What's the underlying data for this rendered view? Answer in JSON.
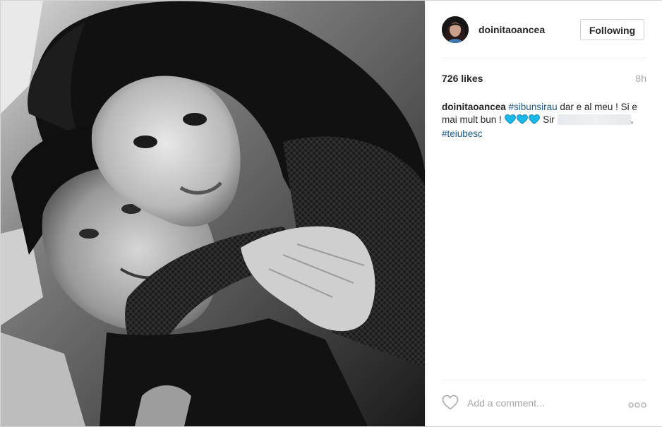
{
  "post": {
    "image_alt": "Black and white photo of a smiling couple, the woman hugging the man from behind",
    "author": {
      "username": "doinitaoancea",
      "avatar_icon": "profile-avatar"
    },
    "follow_button_label": "Following",
    "likes_text": "726 likes",
    "time_ago": "8h",
    "caption": {
      "author": "doinitaoancea",
      "hashtag_1": "#sibunsirau",
      "text_1": " dar e al meu ! Si e mai mult bun ! ",
      "hearts": 3,
      "heart_color": "#1ab7ea",
      "text_2": " Sir ",
      "text_3": ", ",
      "hashtag_2": "#teiubesc"
    },
    "comment": {
      "placeholder": "Add a comment..."
    },
    "icons": {
      "like": "heart-outline-icon",
      "more": "more-options-icon"
    },
    "colors": {
      "hashtag": "#1b5a8b",
      "muted": "#a5a7aa",
      "text": "#262626"
    }
  }
}
